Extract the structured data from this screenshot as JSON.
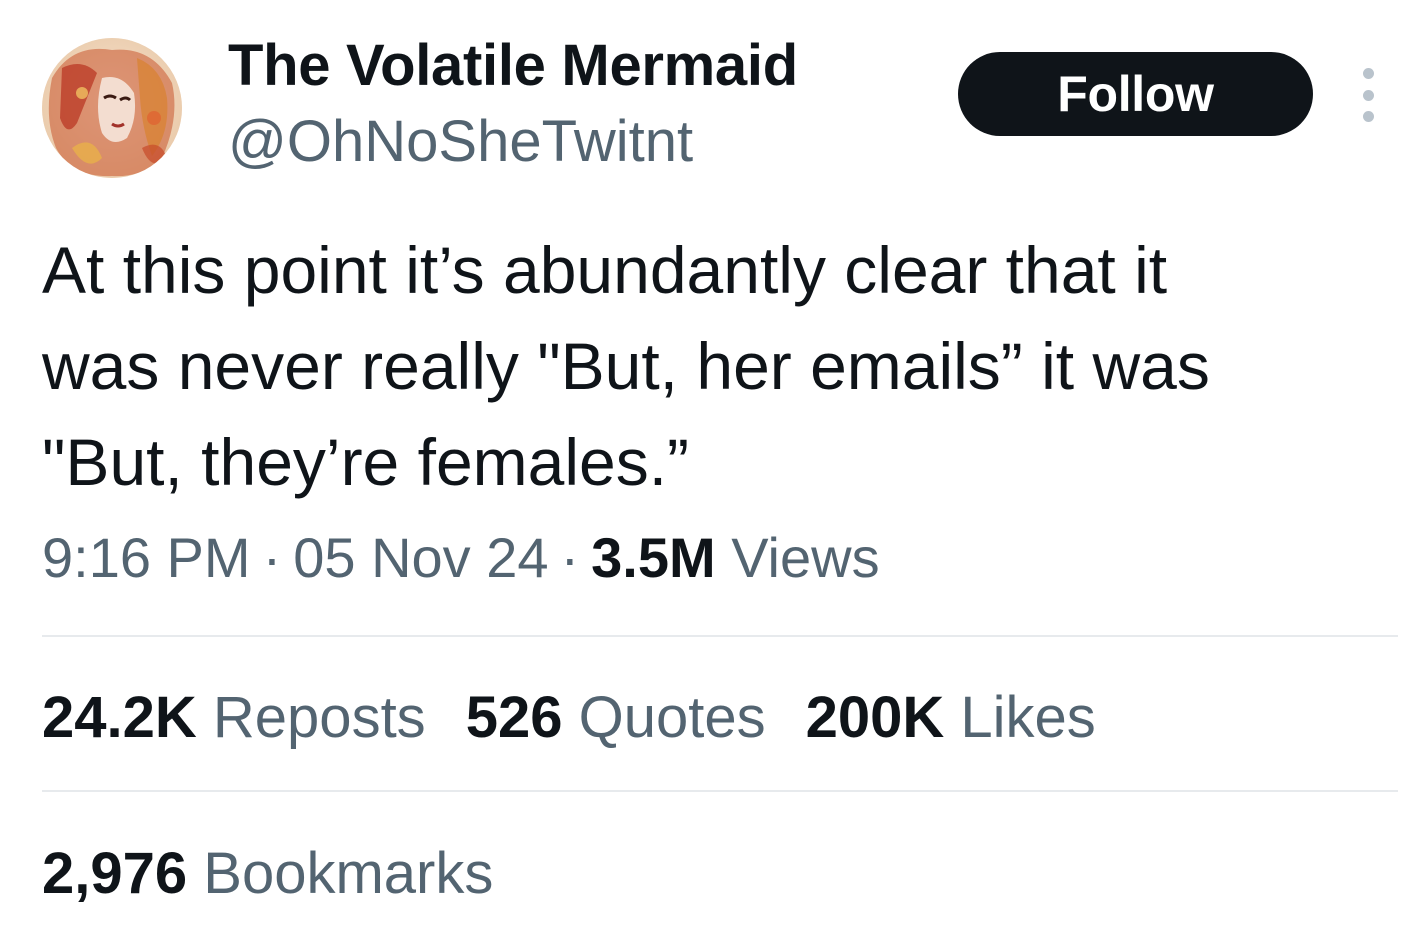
{
  "author": {
    "display_name": "The Volatile Mermaid",
    "handle": "@OhNoSheTwitnt"
  },
  "actions": {
    "follow_label": "Follow",
    "more_icon": "more-vertical-icon"
  },
  "tweet": {
    "lines": [
      "At this point it’s abundantly clear that it",
      "was never really \"But, her emails” it was",
      "\"But, they’re females.”"
    ]
  },
  "meta": {
    "time": "9:16 PM",
    "date": "05 Nov 24",
    "separator": "·",
    "views_count": "3.5M",
    "views_label": "Views"
  },
  "stats": {
    "reposts_count": "24.2K",
    "reposts_label": "Reposts",
    "quotes_count": "526",
    "quotes_label": "Quotes",
    "likes_count": "200K",
    "likes_label": "Likes",
    "bookmarks_count": "2,976",
    "bookmarks_label": "Bookmarks"
  },
  "colors": {
    "text_primary": "#0f1419",
    "text_secondary": "#536471",
    "button_bg": "#0f1419",
    "divider": "#e7eaed"
  }
}
